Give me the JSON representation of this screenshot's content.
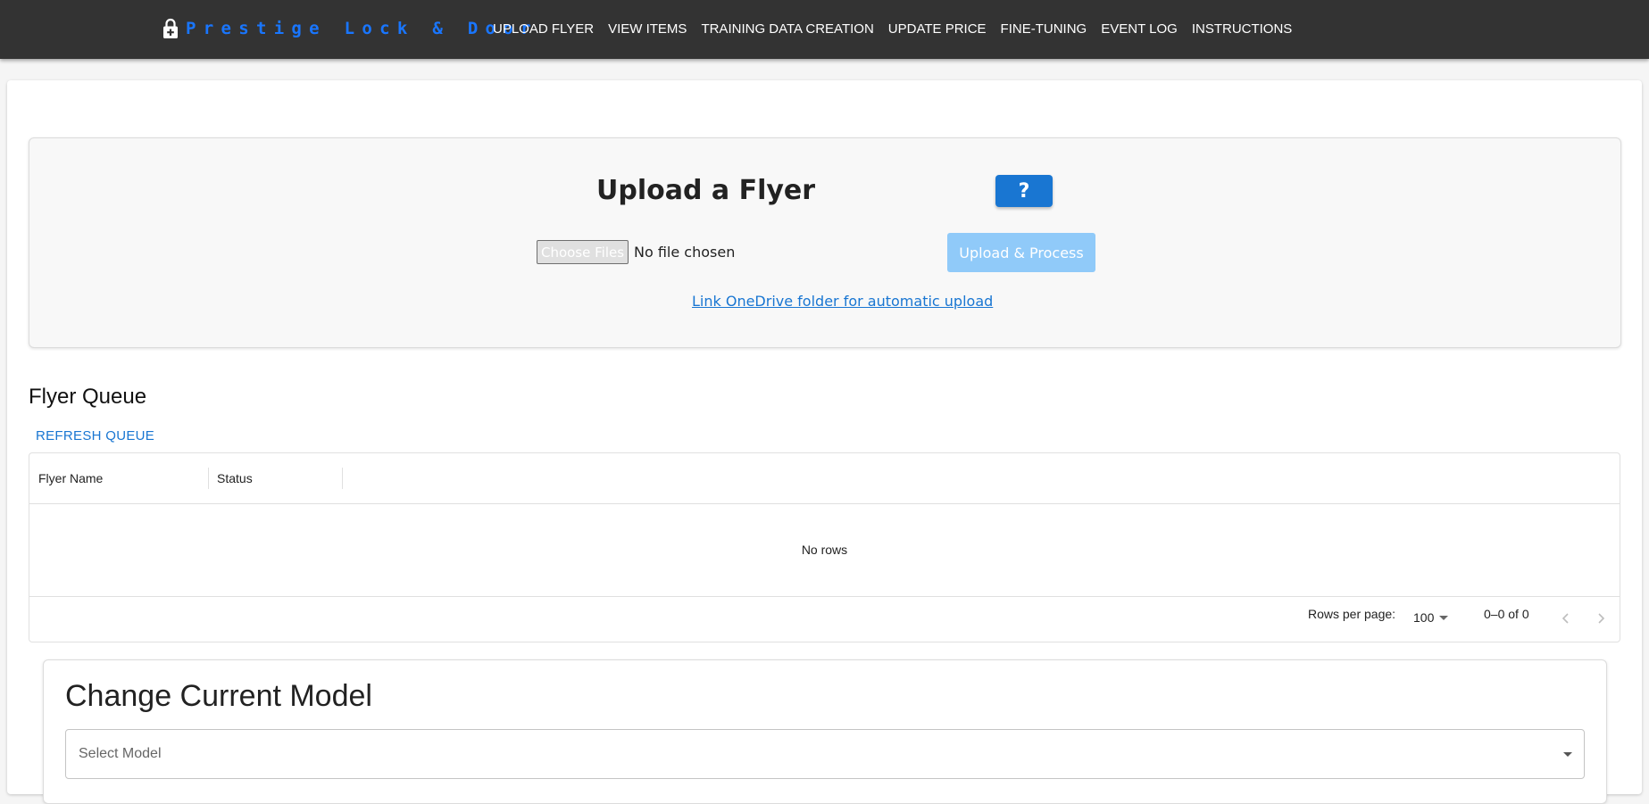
{
  "brand": {
    "name": "Prestige Lock & Door",
    "icon": "lock-plus-icon",
    "color": "#1976ff"
  },
  "nav": {
    "items": [
      {
        "label": "UPLOAD FLYER"
      },
      {
        "label": "VIEW ITEMS"
      },
      {
        "label": "TRAINING DATA CREATION"
      },
      {
        "label": "UPDATE PRICE"
      },
      {
        "label": "FINE-TUNING"
      },
      {
        "label": "EVENT LOG"
      },
      {
        "label": "INSTRUCTIONS"
      }
    ]
  },
  "upload": {
    "title": "Upload a Flyer",
    "help_label": "?",
    "choose_files_label": "Choose Files",
    "file_status": "No file chosen",
    "process_label": "Upload & Process",
    "onedrive_link": "Link OneDrive folder for automatic upload"
  },
  "queue": {
    "title": "Flyer Queue",
    "refresh_label": "REFRESH QUEUE",
    "columns": [
      "Flyer Name",
      "Status"
    ],
    "empty_text": "No rows",
    "rows_per_page_label": "Rows per page:",
    "rows_per_page_value": "100",
    "range_text": "0–0 of 0"
  },
  "model": {
    "title": "Change Current Model",
    "select_placeholder": "Select Model"
  },
  "colors": {
    "topbar": "#333333",
    "primary": "#1976d2",
    "primary_disabled": "#90caf9"
  }
}
